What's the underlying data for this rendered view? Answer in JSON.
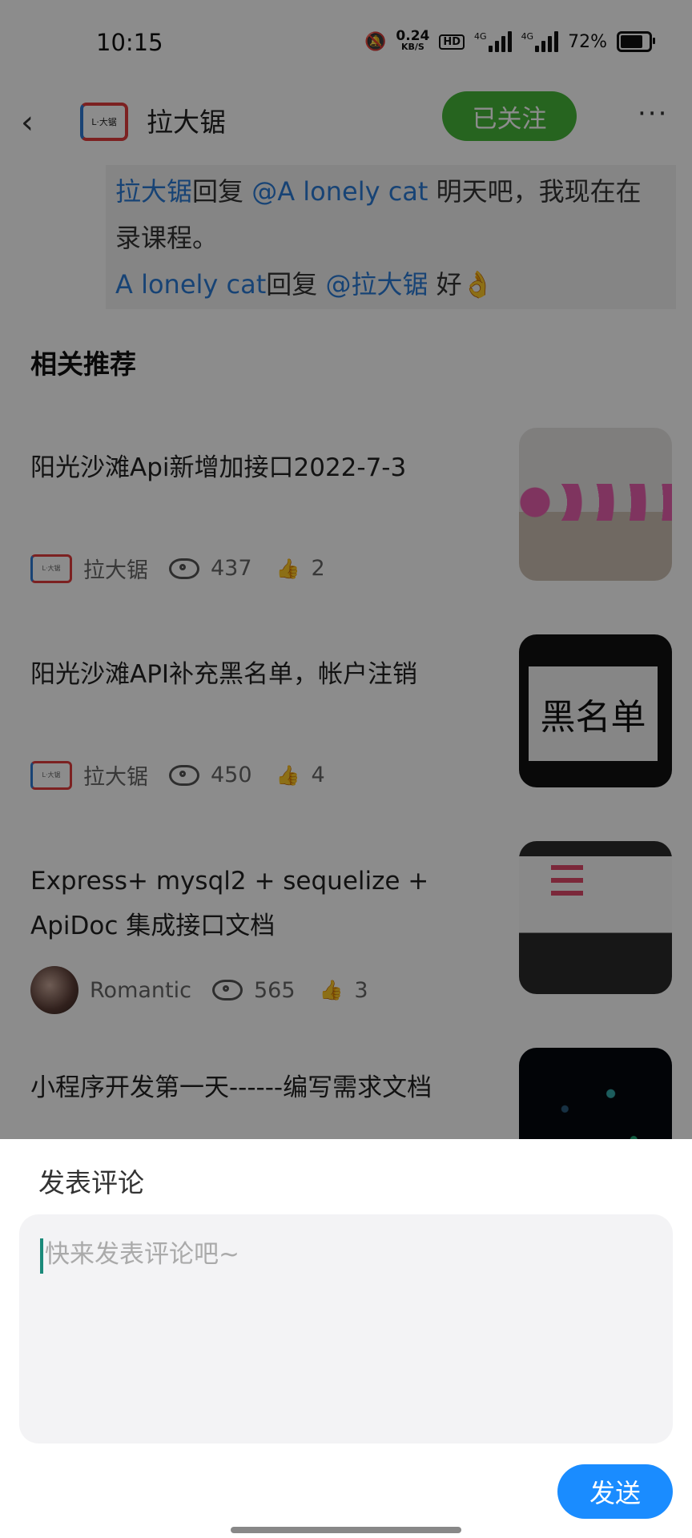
{
  "status_bar": {
    "time": "10:15",
    "net_speed_top": "0.24",
    "net_speed_bottom": "KB/S",
    "hd": "HD",
    "net1": "4G",
    "net2": "4G",
    "battery": "72%"
  },
  "header": {
    "back_icon": "chevron-left-icon",
    "title": "拉大锯",
    "follow_label": "已关注",
    "more_icon": "more-dots-icon",
    "logo_text": "L·大锯"
  },
  "comments": [
    {
      "author": "拉大锯",
      "reply_word": "回复",
      "mention": "@A lonely cat",
      "text": " 明天吧，我现在在录课程。"
    },
    {
      "author": "A lonely cat",
      "reply_word": "回复",
      "mention": "@拉大锯",
      "text": " 好👌"
    }
  ],
  "section_title": "相关推荐",
  "articles": [
    {
      "title": "阳光沙滩Api新增加接口2022-7-3",
      "author": "拉大锯",
      "views": "437",
      "likes": "2"
    },
    {
      "title": "阳光沙滩API补充黑名单，帐户注销",
      "author": "拉大锯",
      "views": "450",
      "likes": "4",
      "thumb_text": "黑名单"
    },
    {
      "title": "Express+  mysql2 + sequelize + ApiDoc 集成接口文档",
      "author": "Romantic",
      "views": "565",
      "likes": "3"
    },
    {
      "title": "小程序开发第一天------编写需求文档"
    }
  ],
  "sheet": {
    "title": "发表评论",
    "placeholder": "快来发表评论吧~",
    "send_label": "发送"
  },
  "colors": {
    "accent": "#1a8cff",
    "follow_green": "#46b63a",
    "link_blue": "#2b7bd6"
  }
}
